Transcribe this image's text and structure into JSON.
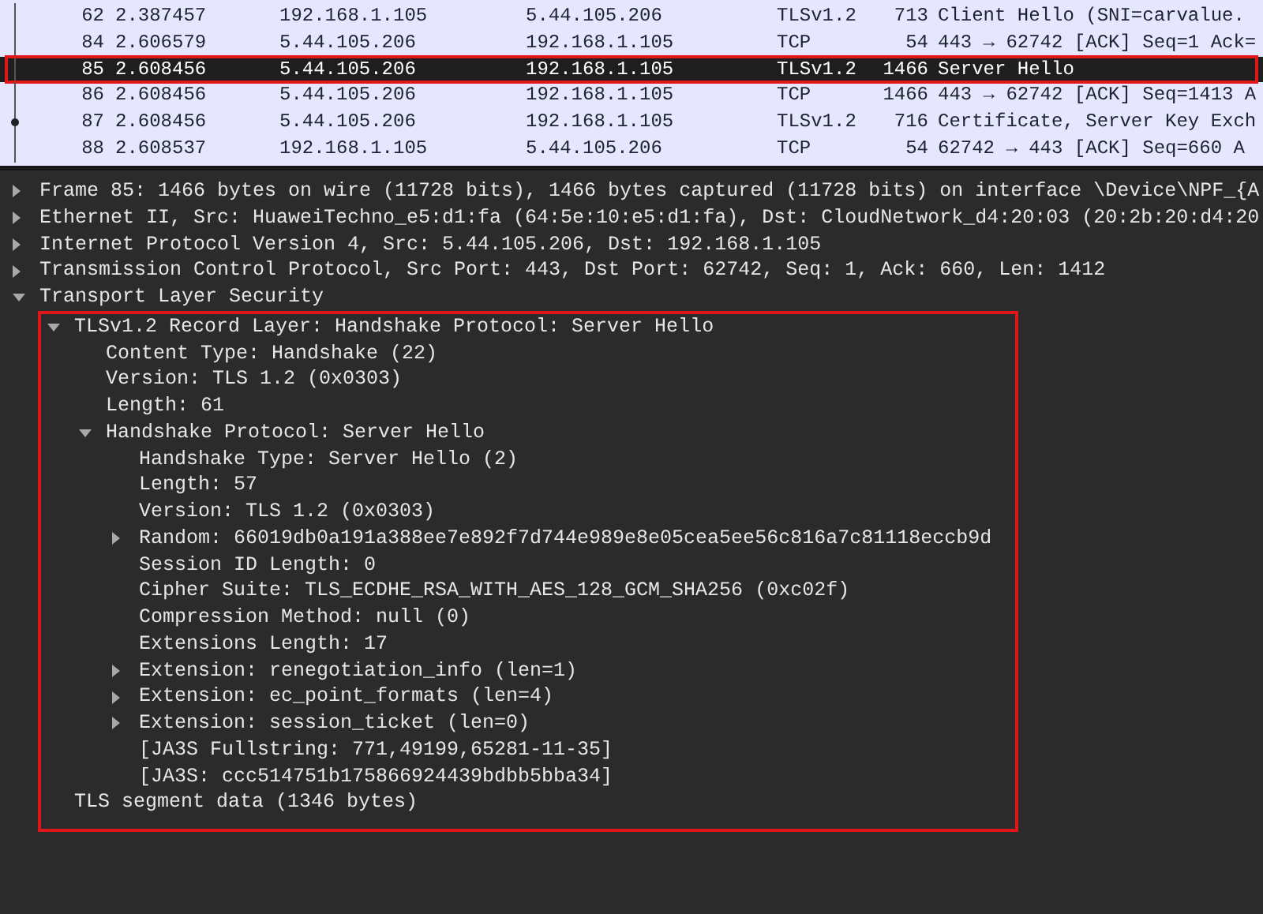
{
  "packet_list": {
    "rows": [
      {
        "no": "62",
        "time": "2.387457",
        "source": "192.168.1.105",
        "destination": "5.44.105.206",
        "protocol": "TLSv1.2",
        "length": "713",
        "info": "Client Hello (SNI=carvalue.",
        "selected": false,
        "highlighted": false,
        "marker": false
      },
      {
        "no": "84",
        "time": "2.606579",
        "source": "5.44.105.206",
        "destination": "192.168.1.105",
        "protocol": "TCP",
        "length": "54",
        "info": "443 → 62742 [ACK] Seq=1 Ack=",
        "selected": false,
        "highlighted": false,
        "marker": false
      },
      {
        "no": "85",
        "time": "2.608456",
        "source": "5.44.105.206",
        "destination": "192.168.1.105",
        "protocol": "TLSv1.2",
        "length": "1466",
        "info": "Server Hello",
        "selected": true,
        "highlighted": true,
        "marker": false
      },
      {
        "no": "86",
        "time": "2.608456",
        "source": "5.44.105.206",
        "destination": "192.168.1.105",
        "protocol": "TCP",
        "length": "1466",
        "info": "443 → 62742 [ACK] Seq=1413 A",
        "selected": false,
        "highlighted": false,
        "marker": false
      },
      {
        "no": "87",
        "time": "2.608456",
        "source": "5.44.105.206",
        "destination": "192.168.1.105",
        "protocol": "TLSv1.2",
        "length": "716",
        "info": "Certificate, Server Key Exch",
        "selected": false,
        "highlighted": false,
        "marker": true
      },
      {
        "no": "88",
        "time": "2.608537",
        "source": "192.168.1.105",
        "destination": "5.44.105.206",
        "protocol": "TCP",
        "length": "54",
        "info": "62742 → 443 [ACK] Seq=660 A",
        "selected": false,
        "highlighted": false,
        "marker": false
      }
    ]
  },
  "packet_details": {
    "items": [
      {
        "text": "Frame 85: 1466 bytes on wire (11728 bits), 1466 bytes captured (11728 bits) on interface \\Device\\NPF_{A",
        "kind": "branch",
        "expanded": false,
        "highlight_children": false
      },
      {
        "text": "Ethernet II, Src: HuaweiTechno_e5:d1:fa (64:5e:10:e5:d1:fa), Dst: CloudNetwork_d4:20:03 (20:2b:20:d4:20",
        "kind": "branch",
        "expanded": false,
        "highlight_children": false
      },
      {
        "text": "Internet Protocol Version 4, Src: 5.44.105.206, Dst: 192.168.1.105",
        "kind": "branch",
        "expanded": false,
        "highlight_children": false
      },
      {
        "text": "Transmission Control Protocol, Src Port: 443, Dst Port: 62742, Seq: 1, Ack: 660, Len: 1412",
        "kind": "branch",
        "expanded": false,
        "highlight_children": false
      },
      {
        "text": "Transport Layer Security",
        "kind": "branch",
        "expanded": true,
        "highlight_children": true,
        "children": [
          {
            "text": "TLSv1.2 Record Layer: Handshake Protocol: Server Hello",
            "kind": "branch",
            "expanded": true,
            "children": [
              {
                "text": "Content Type: Handshake (22)",
                "kind": "leaf"
              },
              {
                "text": "Version: TLS 1.2 (0x0303)",
                "kind": "leaf"
              },
              {
                "text": "Length: 61",
                "kind": "leaf"
              },
              {
                "text": "Handshake Protocol: Server Hello",
                "kind": "branch",
                "expanded": true,
                "children": [
                  {
                    "text": "Handshake Type: Server Hello (2)",
                    "kind": "leaf"
                  },
                  {
                    "text": "Length: 57",
                    "kind": "leaf"
                  },
                  {
                    "text": "Version: TLS 1.2 (0x0303)",
                    "kind": "leaf"
                  },
                  {
                    "text": "Random: 66019db0a191a388ee7e892f7d744e989e8e05cea5ee56c816a7c81118eccb9d",
                    "kind": "branch",
                    "expanded": false
                  },
                  {
                    "text": "Session ID Length: 0",
                    "kind": "leaf"
                  },
                  {
                    "text": "Cipher Suite: TLS_ECDHE_RSA_WITH_AES_128_GCM_SHA256 (0xc02f)",
                    "kind": "leaf"
                  },
                  {
                    "text": "Compression Method: null (0)",
                    "kind": "leaf"
                  },
                  {
                    "text": "Extensions Length: 17",
                    "kind": "leaf"
                  },
                  {
                    "text": "Extension: renegotiation_info (len=1)",
                    "kind": "branch",
                    "expanded": false
                  },
                  {
                    "text": "Extension: ec_point_formats (len=4)",
                    "kind": "branch",
                    "expanded": false
                  },
                  {
                    "text": "Extension: session_ticket (len=0)",
                    "kind": "branch",
                    "expanded": false
                  },
                  {
                    "text": "[JA3S Fullstring: 771,49199,65281-11-35]",
                    "kind": "leaf"
                  },
                  {
                    "text": "[JA3S: ccc514751b175866924439bdbb5bba34]",
                    "kind": "leaf"
                  }
                ]
              }
            ]
          },
          {
            "text": "TLS segment data (1346 bytes)",
            "kind": "leaf"
          }
        ]
      }
    ]
  }
}
